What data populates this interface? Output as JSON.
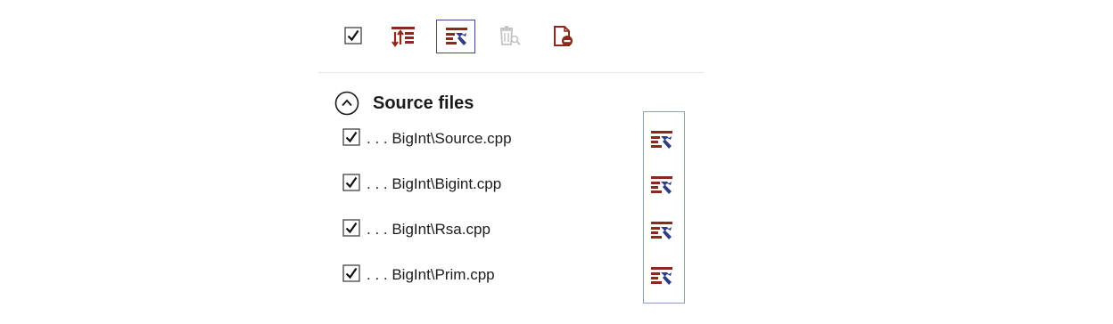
{
  "toolbar": {
    "buttons": [
      {
        "id": "select-all",
        "icon": "checkbox-checked-icon",
        "checked": true
      },
      {
        "id": "sort",
        "icon": "sort-list-icon"
      },
      {
        "id": "configure",
        "icon": "configure-wrench-icon",
        "selected": true
      },
      {
        "id": "clean",
        "icon": "trash-search-icon",
        "enabled": false
      },
      {
        "id": "remove",
        "icon": "document-remove-icon"
      }
    ]
  },
  "section": {
    "title": "Source files",
    "expanded": true
  },
  "files": [
    {
      "path": ". . . BigInt\\Source.cpp",
      "checked": true
    },
    {
      "path": ". . . BigInt\\Bigint.cpp",
      "checked": true
    },
    {
      "path": ". . . BigInt\\Rsa.cpp",
      "checked": true
    },
    {
      "path": ". . . BigInt\\Prim.cpp",
      "checked": true
    }
  ],
  "colors": {
    "icon_red": "#8b2a1c",
    "icon_blue": "#2f3c80",
    "selection_border": "#3a4a8c",
    "disabled_gray": "#bdbdbd"
  }
}
